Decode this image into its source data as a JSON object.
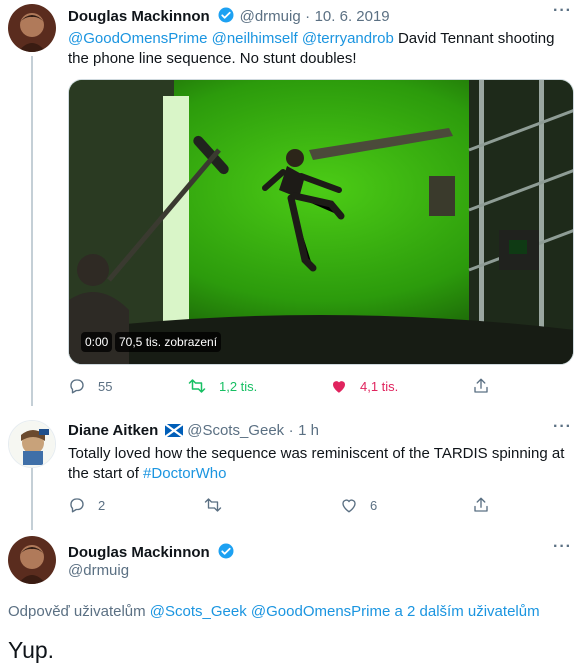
{
  "tweet": {
    "author_name": "Douglas Mackinnon",
    "handle": "@drmuig",
    "date": "10. 6. 2019",
    "mentions": "@GoodOmensPrime @neilhimself @terryandrob",
    "text": "David Tennant shooting the phone line sequence. No stunt doubles!",
    "video": {
      "duration": "0:00",
      "views": "70,5 tis. zobrazení"
    },
    "stats": {
      "replies": "55",
      "retweets": "1,2 tis.",
      "likes": "4,1 tis."
    },
    "liked": true
  },
  "reply": {
    "author_name": "Diane Aitken",
    "handle": "@Scots_Geek",
    "time": "1 h",
    "text": "Totally loved how the sequence  was reminiscent of the TARDIS spinning at the start of",
    "hashtag": "#DoctorWho",
    "stats": {
      "replies": "2",
      "retweets": "",
      "likes": "6"
    }
  },
  "focus": {
    "author_name": "Douglas Mackinnon",
    "handle": "@drmuig",
    "reply_prefix": "Odpověď uživatelům",
    "reply_mentions": "@Scots_Geek @GoodOmensPrime",
    "reply_suffix": "a 2 dalším uživatelům",
    "text": "Yup."
  },
  "colors": {
    "link": "#1b95e0",
    "retweet_green": "#17bf63",
    "like_pink": "#e0245e",
    "verified_blue": "#1da1f2",
    "muted": "#5b7083"
  }
}
